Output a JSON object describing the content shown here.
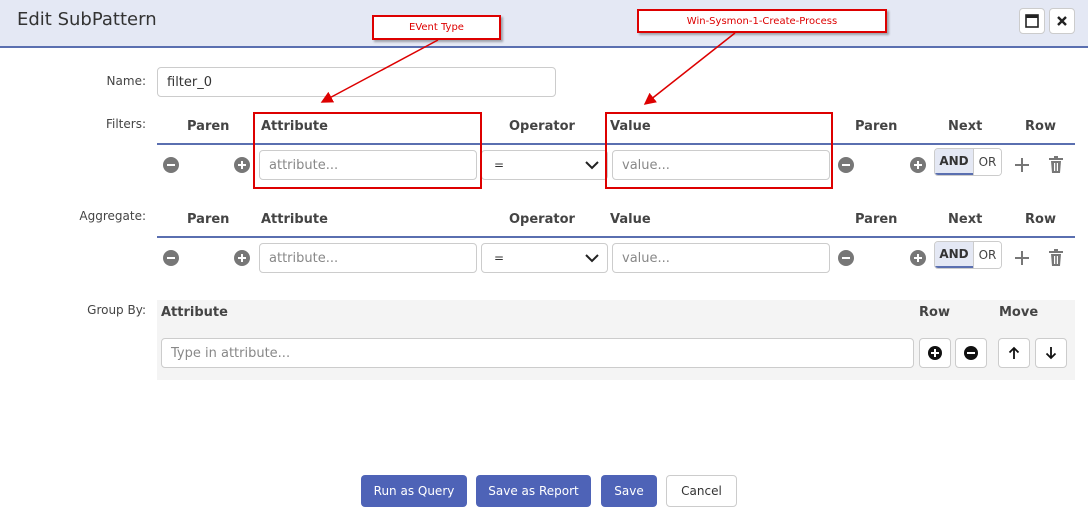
{
  "dialog": {
    "title": "Edit SubPattern"
  },
  "form": {
    "name_label": "Name:",
    "name_value": "filter_0",
    "filters_label": "Filters:",
    "aggregate_label": "Aggregate:",
    "group_by_label": "Group By:"
  },
  "columns": {
    "paren": "Paren",
    "attribute": "Attribute",
    "operator": "Operator",
    "value": "Value",
    "next": "Next",
    "row": "Row",
    "move": "Move"
  },
  "filters_row": {
    "attribute_placeholder": "attribute...",
    "operator": "=",
    "value_placeholder": "value...",
    "and_label": "AND",
    "or_label": "OR"
  },
  "aggregate_row": {
    "attribute_placeholder": "attribute...",
    "operator": "=",
    "value_placeholder": "value...",
    "and_label": "AND",
    "or_label": "OR"
  },
  "group_by": {
    "attribute_placeholder": "Type in attribute..."
  },
  "buttons": {
    "run_as_query": "Run as Query",
    "save_as_report": "Save as Report",
    "save": "Save",
    "cancel": "Cancel"
  },
  "annotations": {
    "event_type": "EVent Type",
    "value_note": "Win-Sysmon-1-Create-Process"
  },
  "colors": {
    "accent": "#5a6fb0",
    "primary_button": "#4e63b7",
    "annotation_red": "#dd0000"
  }
}
